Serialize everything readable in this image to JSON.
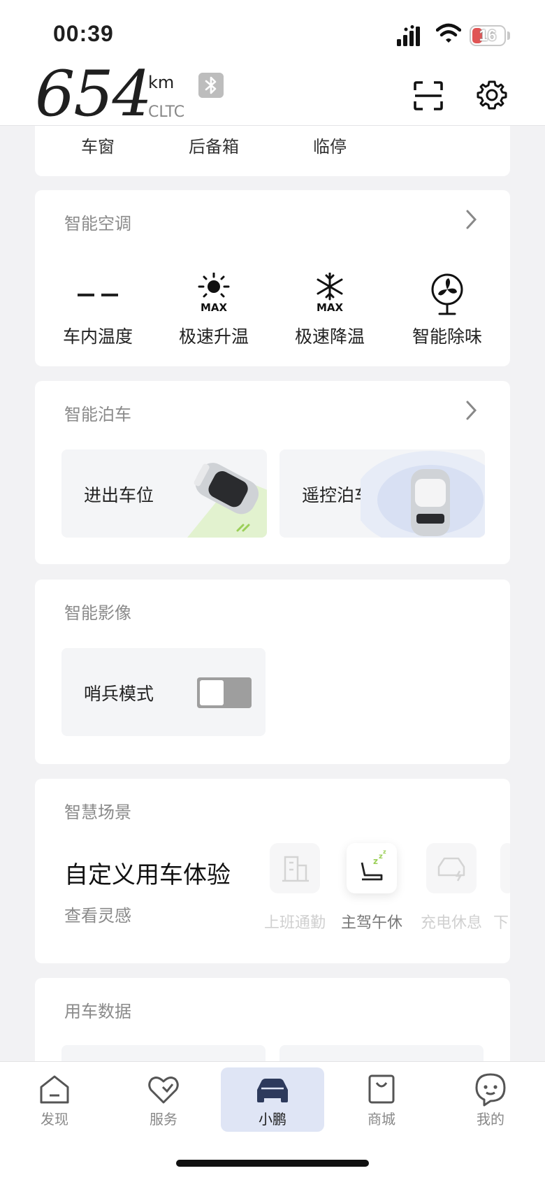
{
  "status": {
    "time": "00:39",
    "battery": "16"
  },
  "header": {
    "range_value": "654",
    "range_unit": "km",
    "range_standard": "CLTC"
  },
  "quick_controls": [
    "车窗",
    "后备箱",
    "临停"
  ],
  "climate": {
    "title": "智能空调",
    "items": [
      {
        "label": "车内温度",
        "value": "– –",
        "icon": "temperature-dash"
      },
      {
        "label": "极速升温",
        "icon": "sun-max-icon"
      },
      {
        "label": "极速降温",
        "icon": "snowflake-max-icon"
      },
      {
        "label": "智能除味",
        "icon": "fan-icon"
      }
    ],
    "max_text": "MAX"
  },
  "parking": {
    "title": "智能泊车",
    "tiles": [
      {
        "label": "进出车位"
      },
      {
        "label": "遥控泊车"
      }
    ]
  },
  "imaging": {
    "title": "智能影像",
    "sentry_label": "哨兵模式",
    "sentry_on": false
  },
  "scenes": {
    "title": "智慧场景",
    "headline": "自定义用车体验",
    "sub": "查看灵感",
    "items": [
      {
        "label": "上班通勤",
        "icon": "office-building-icon"
      },
      {
        "label": "主驾午休",
        "icon": "seat-sleep-icon"
      },
      {
        "label": "充电休息",
        "icon": "car-charging-icon"
      },
      {
        "label": "下"
      }
    ]
  },
  "usage": {
    "title": "用车数据"
  },
  "tabs": [
    {
      "label": "发现",
      "icon": "home-icon"
    },
    {
      "label": "服务",
      "icon": "heart-icon"
    },
    {
      "label": "小鹏",
      "icon": "car-icon",
      "active": true
    },
    {
      "label": "商城",
      "icon": "shopping-bag-icon"
    },
    {
      "label": "我的",
      "icon": "smiley-chat-icon"
    }
  ],
  "colors": {
    "accent_tab": "#dfe5f5",
    "battery_low": "#e05454",
    "toggle_off": "#9e9e9e"
  }
}
